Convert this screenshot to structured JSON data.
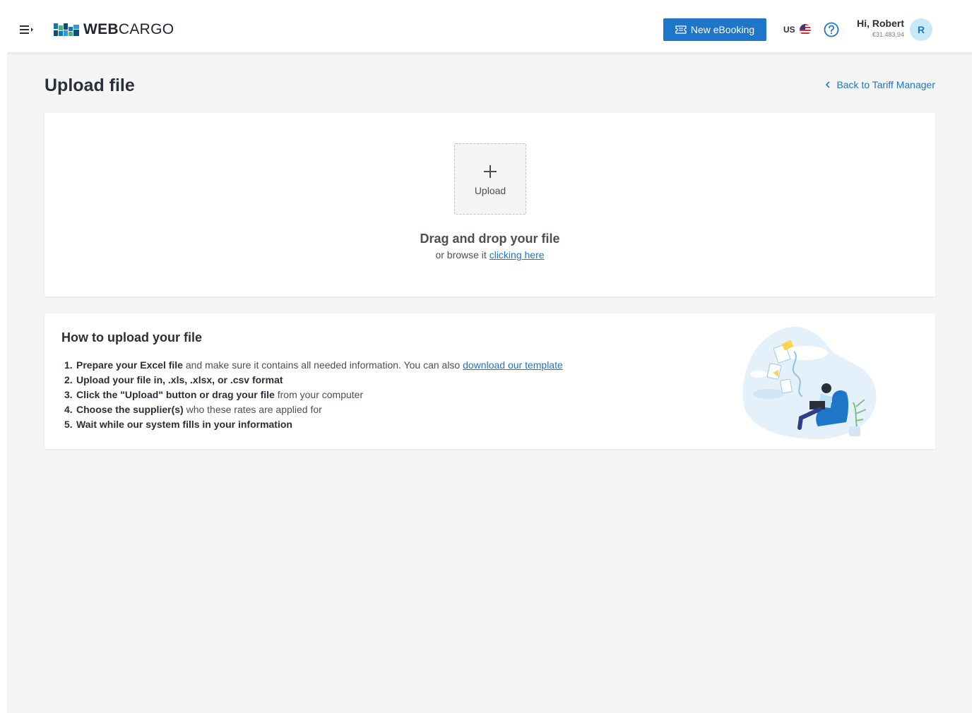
{
  "header": {
    "logo": {
      "bold": "WEB",
      "light": "CARGO"
    },
    "new_booking_label": "New eBooking",
    "locale": "US",
    "user": {
      "greeting": "Hi, Robert",
      "balance": "€31.483,94",
      "avatar_initial": "R"
    }
  },
  "page": {
    "title": "Upload file",
    "back_link": "Back to Tariff Manager"
  },
  "upload": {
    "button_label": "Upload",
    "drop_title": "Drag and drop your file",
    "drop_sub_prefix": "or browse it ",
    "drop_sub_link": "clicking here"
  },
  "howto": {
    "title": "How to upload your file",
    "steps": [
      {
        "num": "1.",
        "bold": "Prepare your Excel file",
        "rest": " and make sure it contains all needed information. You can also ",
        "link": "download our template"
      },
      {
        "num": "2.",
        "bold": "Upload your file in, .xls, .xlsx, or .csv format",
        "rest": ""
      },
      {
        "num": "3.",
        "bold": "Click the \"Upload\" button or drag your file",
        "rest": " from your computer"
      },
      {
        "num": "4.",
        "bold": "Choose the supplier(s)",
        "rest": " who these rates are applied for"
      },
      {
        "num": "5.",
        "bold": "Wait while our system fills in your information",
        "rest": ""
      }
    ]
  },
  "colors": {
    "primary": "#1f75c7",
    "background": "#f5f5f5",
    "avatar_bg": "#c7eaf6",
    "text": "#2a2f3a"
  },
  "icons": {
    "menu": "menu-toggle-icon",
    "booking": "ticket-icon",
    "flag": "us-flag-icon",
    "help": "help-circle-icon",
    "back": "chevron-left-icon",
    "upload": "plus-icon"
  }
}
